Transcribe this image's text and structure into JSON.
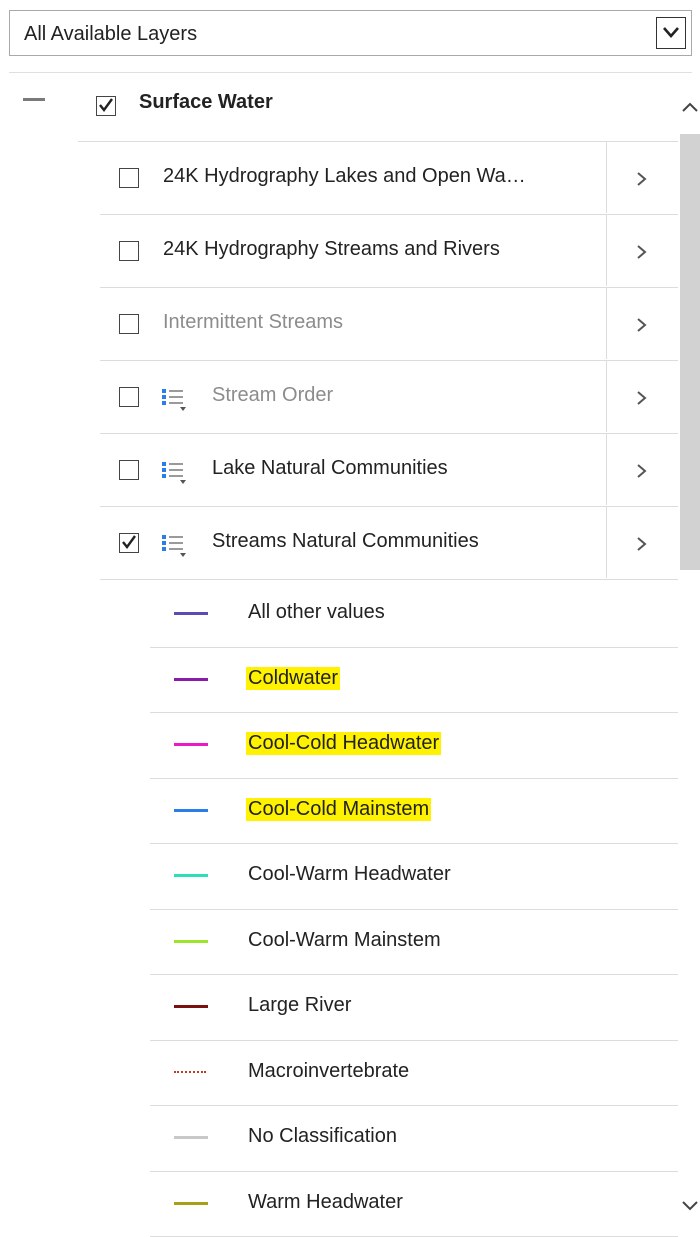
{
  "dropdown": {
    "selected": "All Available Layers"
  },
  "group": {
    "title": "Surface Water",
    "checked": true
  },
  "layers": [
    {
      "label": "24K Hydrography Lakes and Open Wa…",
      "checked": false,
      "greyed": false,
      "has_legend_icon": false
    },
    {
      "label": "24K Hydrography Streams and Rivers",
      "checked": false,
      "greyed": false,
      "has_legend_icon": false
    },
    {
      "label": "Intermittent Streams",
      "checked": false,
      "greyed": true,
      "has_legend_icon": false
    },
    {
      "label": "Stream Order",
      "checked": false,
      "greyed": true,
      "has_legend_icon": true
    },
    {
      "label": "Lake Natural Communities",
      "checked": false,
      "greyed": false,
      "has_legend_icon": true
    },
    {
      "label": "Streams Natural Communities",
      "checked": true,
      "greyed": false,
      "has_legend_icon": true
    }
  ],
  "legend": [
    {
      "label": "All other values",
      "color": "#5b4bb7",
      "style": "solid",
      "highlighted": false
    },
    {
      "label": "Coldwater",
      "color": "#8a1aa8",
      "style": "solid",
      "highlighted": true
    },
    {
      "label": "Cool-Cold Headwater",
      "color": "#e81cc6",
      "style": "solid",
      "highlighted": true
    },
    {
      "label": "Cool-Cold Mainstem",
      "color": "#2b7de9",
      "style": "solid",
      "highlighted": true
    },
    {
      "label": "Cool-Warm Headwater",
      "color": "#2de0b4",
      "style": "solid",
      "highlighted": false
    },
    {
      "label": "Cool-Warm Mainstem",
      "color": "#9be52a",
      "style": "solid",
      "highlighted": false
    },
    {
      "label": "Large River",
      "color": "#7a1010",
      "style": "solid",
      "highlighted": false
    },
    {
      "label": "Macroinvertebrate",
      "color": "#c0392b",
      "style": "dotted",
      "highlighted": false
    },
    {
      "label": "No Classification",
      "color": "#c8c8c8",
      "style": "solid",
      "highlighted": false
    },
    {
      "label": "Warm Headwater",
      "color": "#a6a01a",
      "style": "solid",
      "highlighted": false
    }
  ],
  "icons": {
    "dropdown_arrow": "chevron-down-icon",
    "collapse": "minus-icon",
    "row_expand": "chevron-right-icon",
    "legend": "legend-list-icon",
    "scroll_up": "chevron-up-icon",
    "scroll_down": "chevron-down-icon"
  }
}
